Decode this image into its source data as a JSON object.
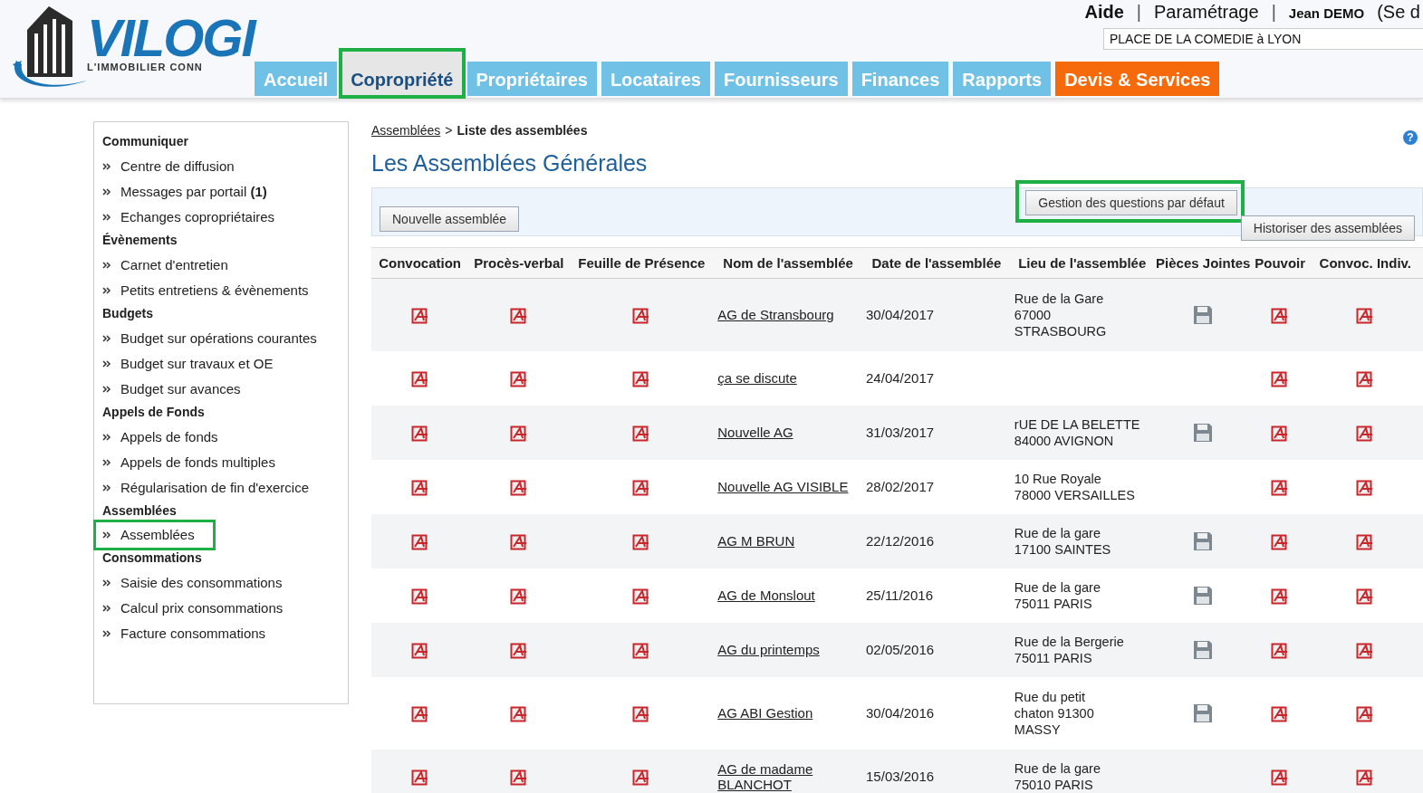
{
  "logo": {
    "name": "VILOGI",
    "tagline": "L'IMMOBILIER CONN"
  },
  "top_links": [
    {
      "label": "Aide",
      "kind": "bold"
    },
    {
      "label": "|",
      "kind": "separator"
    },
    {
      "label": "Paramétrage",
      "kind": "link"
    },
    {
      "label": "|",
      "kind": "separator"
    },
    {
      "label": "Jean DEMO",
      "kind": "user"
    },
    {
      "label": "(Se d",
      "kind": "link"
    }
  ],
  "site_select": {
    "value": "PLACE DE LA COMEDIE à LYON"
  },
  "tabs": [
    {
      "label": "Accueil",
      "selected": false,
      "highlighted": false,
      "kind": "normal"
    },
    {
      "label": "Copropriété",
      "selected": true,
      "highlighted": true,
      "kind": "normal"
    },
    {
      "label": "Propriétaires",
      "selected": false,
      "highlighted": false,
      "kind": "normal"
    },
    {
      "label": "Locataires",
      "selected": false,
      "highlighted": false,
      "kind": "normal"
    },
    {
      "label": "Fournisseurs",
      "selected": false,
      "highlighted": false,
      "kind": "normal"
    },
    {
      "label": "Finances",
      "selected": false,
      "highlighted": false,
      "kind": "normal"
    },
    {
      "label": "Rapports",
      "selected": false,
      "highlighted": false,
      "kind": "normal"
    },
    {
      "label": "Devis & Services",
      "selected": false,
      "highlighted": false,
      "kind": "promo"
    }
  ],
  "sidebar": {
    "sections": [
      {
        "title": "Communiquer",
        "items": [
          {
            "label": "Centre de diffusion",
            "selected": false
          },
          {
            "label": "Messages par portail **(1)**",
            "selected": false
          },
          {
            "label": "Echanges copropriétaires",
            "selected": false
          }
        ]
      },
      {
        "title": "Évènements",
        "items": [
          {
            "label": "Carnet d'entretien",
            "selected": false
          },
          {
            "label": "Petits entretiens & évènements",
            "selected": false
          }
        ]
      },
      {
        "title": "Budgets",
        "items": [
          {
            "label": "Budget sur opérations courantes",
            "selected": false
          },
          {
            "label": "Budget sur travaux et OE",
            "selected": false
          },
          {
            "label": "Budget sur avances",
            "selected": false
          }
        ]
      },
      {
        "title": "Appels de Fonds",
        "items": [
          {
            "label": "Appels de fonds",
            "selected": false
          },
          {
            "label": "Appels de fonds multiples",
            "selected": false
          },
          {
            "label": "Régularisation de fin d'exercice",
            "selected": false
          }
        ]
      },
      {
        "title": "Assemblées",
        "items": [
          {
            "label": "Assemblées",
            "selected": true
          }
        ]
      },
      {
        "title": "Consommations",
        "items": [
          {
            "label": "Saisie des consommations",
            "selected": false
          },
          {
            "label": "Calcul prix consommations",
            "selected": false
          },
          {
            "label": "Facture consommations",
            "selected": false
          }
        ]
      }
    ]
  },
  "breadcrumb": {
    "link": "Assemblées",
    "separator": ">",
    "current": "Liste des assemblées"
  },
  "help": "?",
  "title": "Les Assemblées Générales",
  "toolbar": {
    "new_button": "Nouvelle assemblée",
    "questions_button": {
      "label": "Gestion des questions par défaut",
      "highlighted": true
    },
    "archive_button": "Historiser des assemblées"
  },
  "table": {
    "columns": [
      "Convocation",
      "Procès-verbal",
      "Feuille de Présence",
      "Nom de l'assemblée",
      "Date de l'assemblée",
      "Lieu de l'assemblée",
      "Pièces Jointes",
      "Pouvoir",
      "Convoc. Indiv."
    ],
    "rows": [
      {
        "name": "AG de Stransbourg",
        "date": "30/04/2017",
        "place": [
          "Rue de la Gare",
          "67000",
          "STRASBOURG"
        ],
        "attachment": true
      },
      {
        "name": "ça se discute",
        "date": "24/04/2017",
        "place": [],
        "attachment": false
      },
      {
        "name": "Nouvelle AG",
        "date": "31/03/2017",
        "place": [
          "rUE DE LA BELETTE",
          "84000 AVIGNON"
        ],
        "attachment": true
      },
      {
        "name": "Nouvelle AG VISIBLE",
        "date": "28/02/2017",
        "place": [
          "10 Rue Royale",
          "78000 VERSAILLES"
        ],
        "attachment": false
      },
      {
        "name": "AG M BRUN",
        "date": "22/12/2016",
        "place": [
          "Rue de la gare",
          "17100 SAINTES"
        ],
        "attachment": true
      },
      {
        "name": "AG de Monslout",
        "date": "25/11/2016",
        "place": [
          "Rue de la gare",
          "75011 PARIS"
        ],
        "attachment": true
      },
      {
        "name": "AG du printemps",
        "date": "02/05/2016",
        "place": [
          "Rue de la Bergerie",
          "75011 PARIS"
        ],
        "attachment": true
      },
      {
        "name": "AG ABI Gestion",
        "date": "30/04/2016",
        "place": [
          "Rue du petit",
          "chaton 91300",
          "MASSY"
        ],
        "attachment": true
      },
      {
        "name": "AG de madame BLANCHOT",
        "date": "15/03/2016",
        "place": [
          "Rue de la gare",
          "75010 PARIS"
        ],
        "attachment": false
      }
    ]
  }
}
